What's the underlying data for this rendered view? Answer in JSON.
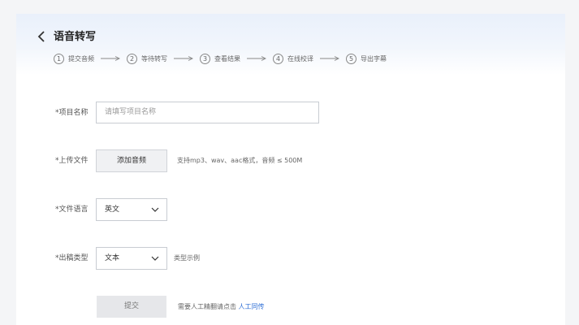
{
  "header": {
    "title": "语音转写",
    "steps": [
      {
        "num": "1",
        "label": "提交音频"
      },
      {
        "num": "2",
        "label": "等待转写"
      },
      {
        "num": "3",
        "label": "查看结果"
      },
      {
        "num": "4",
        "label": "在线校译"
      },
      {
        "num": "5",
        "label": "导出字幕"
      }
    ]
  },
  "form": {
    "project_name": {
      "label": "*项目名称",
      "placeholder": "请填写项目名称",
      "value": ""
    },
    "upload": {
      "label": "*上传文件",
      "button": "添加音频",
      "hint": "支持mp3、wav、aac格式，音频 ≤ 500M"
    },
    "language": {
      "label": "*文件语言",
      "value": "英文"
    },
    "output_type": {
      "label": "*出稿类型",
      "value": "文本",
      "hint": "类型示例"
    },
    "submit": {
      "button": "提交",
      "hint": "需要人工精翻请点击 ",
      "link": "人工同传"
    }
  },
  "colors": {
    "accent": "#2f6fd6",
    "header_bg": "#e9f0fb"
  }
}
